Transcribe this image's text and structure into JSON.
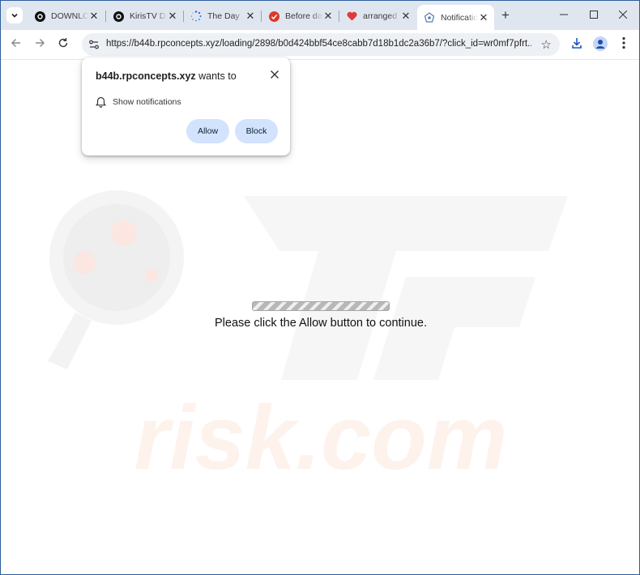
{
  "tabs": [
    {
      "title": "DOWNLOAD",
      "icon": "tiktok-icon"
    },
    {
      "title": "KirisTV Dance",
      "icon": "tiktok-icon"
    },
    {
      "title": "The Day",
      "icon": "loading-spinner-icon"
    },
    {
      "title": "Before dawn",
      "icon": "red-check-icon"
    },
    {
      "title": "arranged",
      "icon": "heart-icon"
    },
    {
      "title": "Notifications",
      "icon": "notification-site-icon",
      "active": true
    }
  ],
  "address_bar": {
    "url": "https://b44b.rpconcepts.xyz/loading/2898/b0d424bbf54ce8cabb7d18b1dc2a36b7/?click_id=wr0mf7pfrt..."
  },
  "popup": {
    "domain": "b44b.rpconcepts.xyz",
    "title_suffix": " wants to",
    "permission": "Show notifications",
    "allow_label": "Allow",
    "block_label": "Block"
  },
  "page": {
    "message": "Please click the Allow button to continue."
  },
  "watermark": {
    "text": "risk.com"
  },
  "colors": {
    "tabstrip_bg": "#dfe6f0",
    "button_bg": "#d3e3fd",
    "frame_border": "#2d5f9b"
  }
}
